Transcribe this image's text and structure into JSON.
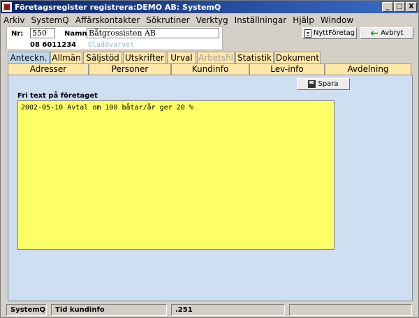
{
  "window": {
    "title": "Företagsregister registrera:DEMO AB: SystemQ",
    "min_label": "_",
    "max_label": "□",
    "close_label": "X"
  },
  "menu": [
    "Arkiv",
    "SystemQ",
    "Affärskontakter",
    "Sökrutiner",
    "Verktyg",
    "Inställningar",
    "Hjälp",
    "Window"
  ],
  "header": {
    "nr_label": "Nr:",
    "nr_value": "550",
    "name_label": "Namn:",
    "name_value": "Båtgrossisten AB",
    "phone": "08 6011234",
    "subname": "Gladövarvet"
  },
  "toolbar": {
    "new_company_label": "NyttFöretag",
    "cancel_label": "Avbryt"
  },
  "tabs_row1": [
    "Anteckn.",
    "Allmän",
    "Säljstöd",
    "Utskrifter",
    "Urval",
    "Arbetsfil",
    "Statistik",
    "Dokument"
  ],
  "tabs_row1_active": "Anteckn.",
  "tabs_row1_disabled": "Arbetsfil",
  "tabs_row2": [
    "Adresser",
    "Personer",
    "Kundinfo",
    "Lev-info",
    "Avdelning"
  ],
  "notes": {
    "save_label": "Spara",
    "section_label": "Fri text på företaget",
    "text": "2002-05-10 Avtal om 100 båtar/år ger 20 %"
  },
  "status": [
    "SystemQ",
    "Tid kundinfo",
    ".251",
    ""
  ],
  "colors": {
    "tab_inactive": "#ffe7a8",
    "tab_active": "#bcd8ef",
    "content_bg": "#cfdff2",
    "notes_bg": "#ffff66",
    "titlebar": "#0a246a"
  }
}
